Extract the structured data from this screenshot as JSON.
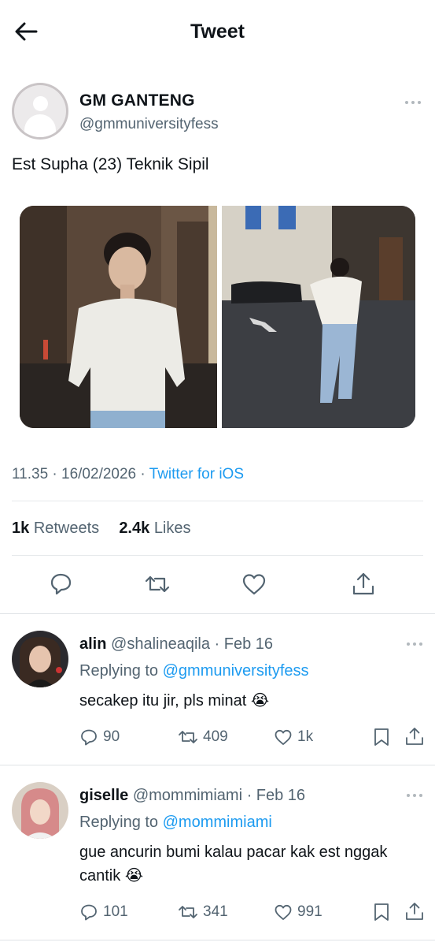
{
  "header": {
    "title": "Tweet"
  },
  "tweet": {
    "author_name": "GM GANTENG",
    "author_handle": "@gmmuniversityfess",
    "text": "Est Supha (23) Teknik Sipil",
    "time": "11.35 · 16/02/2026 · ",
    "source": "Twitter for iOS",
    "retweets": "1k",
    "retweets_label": "Retweets",
    "likes": "2.4k",
    "likes_label": "Likes"
  },
  "replies": [
    {
      "name": "alin",
      "handle_date": "@shalineaqila · Feb 16",
      "replying_prefix": "Replying to ",
      "replying_to": "@gmmuniversityfess",
      "text": "secakep itu jir, pls minat 😭",
      "reply_count": "90",
      "retweet_count": "409",
      "like_count": "1k"
    },
    {
      "name": "giselle",
      "handle_date": "@mommimiami · Feb 16",
      "replying_prefix": "Replying to ",
      "replying_to": "@mommimiami",
      "text": "gue ancurin bumi kalau pacar kak est nggak cantik 😭",
      "reply_count": "101",
      "retweet_count": "341",
      "like_count": "991"
    }
  ],
  "colors": {
    "accent": "#1d9bf0",
    "secondary_text": "#536471",
    "primary_text": "#0f1419"
  },
  "icons": [
    "back-arrow-icon",
    "more-icon",
    "reply-icon",
    "retweet-icon",
    "like-icon",
    "share-icon",
    "bookmark-icon"
  ]
}
